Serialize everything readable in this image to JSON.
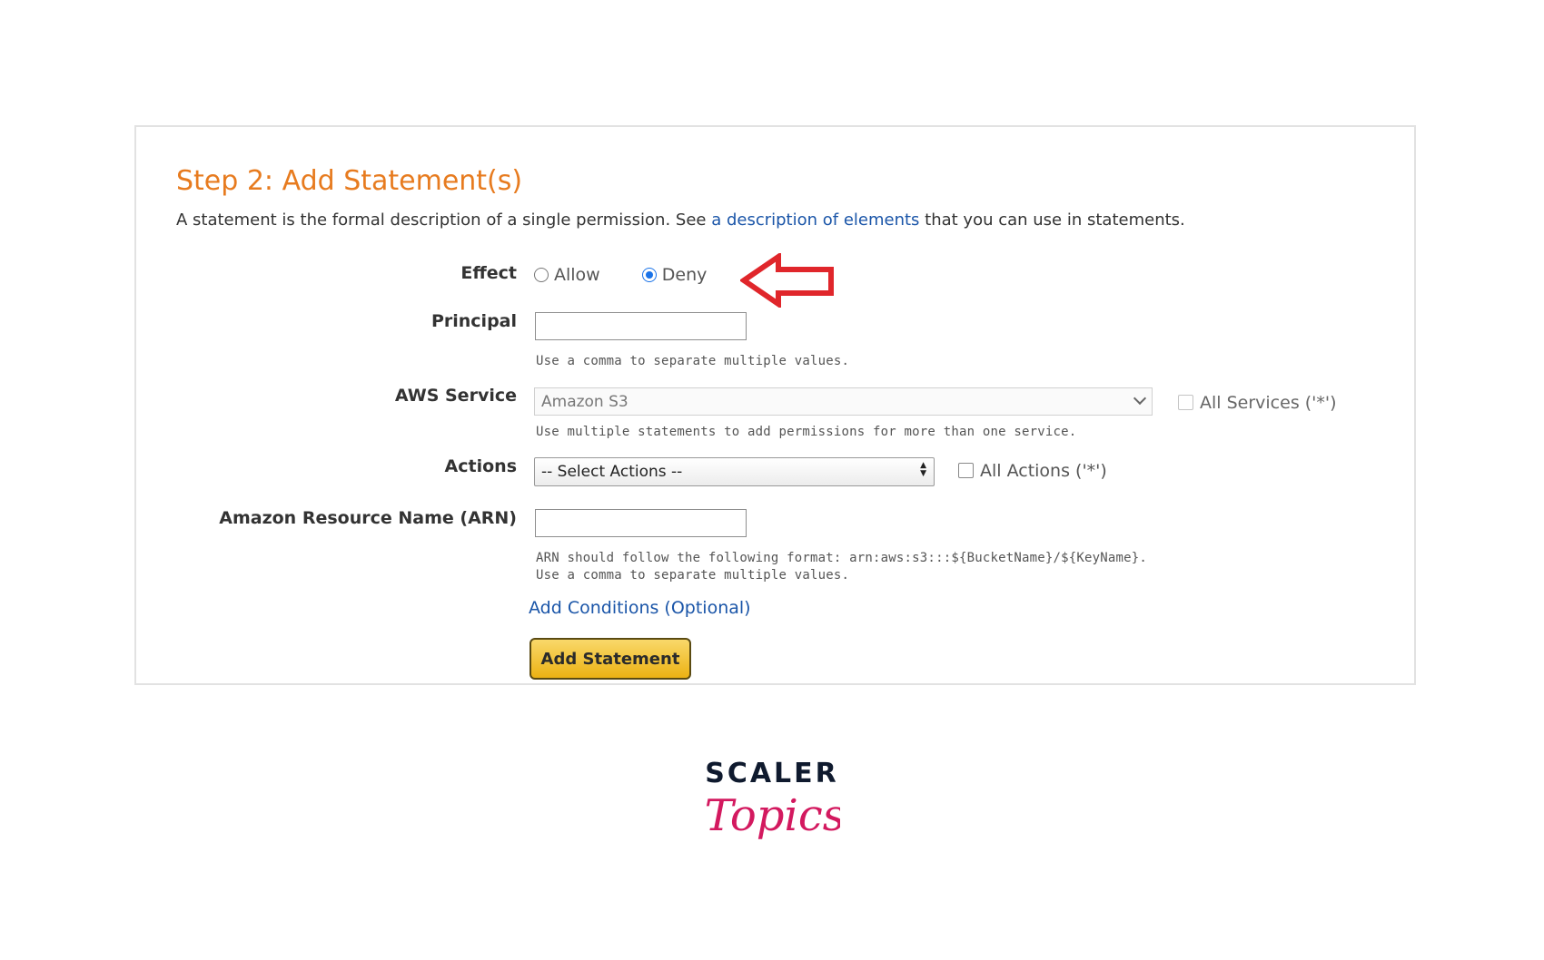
{
  "page": {
    "title": "Step 2: Add Statement(s)",
    "description": {
      "before_link": "A statement is the formal description of a single permission. See ",
      "link": "a description of elements",
      "after_link": " that you can use in statements."
    }
  },
  "form": {
    "effect": {
      "label": "Effect",
      "options": [
        {
          "label": "Allow",
          "selected": false
        },
        {
          "label": "Deny",
          "selected": true
        }
      ]
    },
    "principal": {
      "label": "Principal",
      "value": "",
      "hint": "Use a comma to separate multiple values."
    },
    "aws_service": {
      "label": "AWS Service",
      "selected": "Amazon S3",
      "hint": "Use multiple statements to add permissions for more than one service.",
      "all_checkbox": {
        "label": "All Services ('*')",
        "checked": false
      }
    },
    "actions": {
      "label": "Actions",
      "selected": "-- Select Actions --",
      "all_checkbox": {
        "label": "All Actions ('*')",
        "checked": false
      }
    },
    "arn": {
      "label": "Amazon Resource Name (ARN)",
      "value": "",
      "hint_line1": "ARN should follow the following format: arn:aws:s3:::${BucketName}/${KeyName}.",
      "hint_line2": "Use a comma to separate multiple values."
    },
    "add_conditions_link": "Add Conditions (Optional)",
    "add_statement_button": "Add Statement"
  },
  "logo": {
    "line1": "SCALER",
    "line2": "Topics"
  },
  "colors": {
    "title": "#e77b1f",
    "link": "#1a55a8",
    "arrow": "#e0262b",
    "logo_dark": "#0f1a2e",
    "logo_pink": "#d3195f",
    "button": "#ecb213"
  }
}
